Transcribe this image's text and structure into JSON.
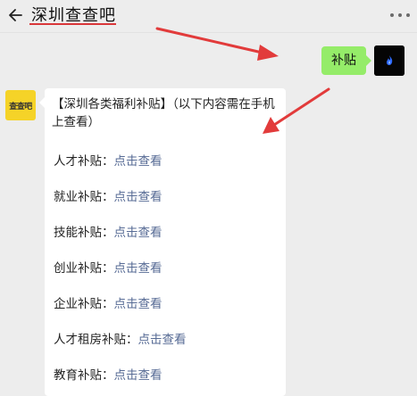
{
  "header": {
    "title": "深圳查查吧"
  },
  "conversation": {
    "my_message": "补贴",
    "my_avatar_icon": "blue-flame-icon",
    "bot_avatar_text": "查查吧",
    "reply_heading": "【深圳各类福利补贴】（以下内容需在手机上查看）",
    "items": [
      {
        "label": "人才补贴：",
        "link": "点击查看"
      },
      {
        "label": "就业补贴：",
        "link": "点击查看"
      },
      {
        "label": "技能补贴：",
        "link": "点击查看"
      },
      {
        "label": "创业补贴：",
        "link": "点击查看"
      },
      {
        "label": "企业补贴：",
        "link": "点击查看"
      },
      {
        "label": "人才租房补贴：",
        "link": "点击查看"
      },
      {
        "label": "教育补贴：",
        "link": "点击查看"
      }
    ]
  },
  "colors": {
    "my_bubble": "#95ec69",
    "link": "#576b95",
    "annotation_arrow": "#e23b3b",
    "title_underline": "#d9373a"
  }
}
